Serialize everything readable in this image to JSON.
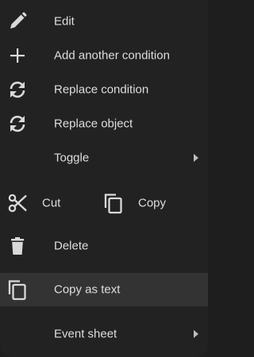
{
  "menu": {
    "items": {
      "edit": {
        "label": "Edit",
        "icon": "pencil-icon"
      },
      "add_condition": {
        "label": "Add another condition",
        "icon": "plus-icon"
      },
      "replace_condition": {
        "label": "Replace condition",
        "icon": "refresh-icon"
      },
      "replace_object": {
        "label": "Replace object",
        "icon": "refresh-icon"
      },
      "toggle": {
        "label": "Toggle",
        "icon": "chevron-right-icon"
      },
      "cut": {
        "label": "Cut",
        "icon": "scissors-icon"
      },
      "copy": {
        "label": "Copy",
        "icon": "copy-icon"
      },
      "delete": {
        "label": "Delete",
        "icon": "trash-icon"
      },
      "copy_as_text": {
        "label": "Copy as text",
        "icon": "copy-icon"
      },
      "event_sheet": {
        "label": "Event sheet",
        "icon": "chevron-right-icon"
      }
    },
    "colors": {
      "background": "#222222",
      "highlight": "#333333",
      "text": "#dedede",
      "icon": "#d9d9d9"
    }
  }
}
